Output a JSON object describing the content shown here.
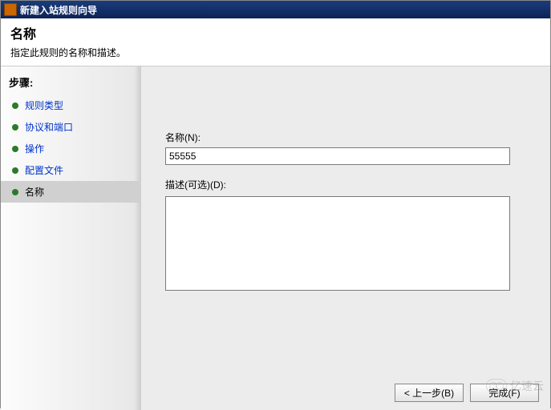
{
  "window": {
    "title": "新建入站规则向导"
  },
  "header": {
    "title": "名称",
    "subtitle": "指定此规则的名称和描述。"
  },
  "sidebar": {
    "title": "步骤:",
    "items": [
      {
        "label": "规则类型"
      },
      {
        "label": "协议和端口"
      },
      {
        "label": "操作"
      },
      {
        "label": "配置文件"
      },
      {
        "label": "名称"
      }
    ]
  },
  "form": {
    "name_label": "名称(N):",
    "name_value": "55555",
    "desc_label": "描述(可选)(D):",
    "desc_value": ""
  },
  "buttons": {
    "back": "< 上一步(B)",
    "finish": "完成(F)"
  },
  "watermark": "亿速云"
}
